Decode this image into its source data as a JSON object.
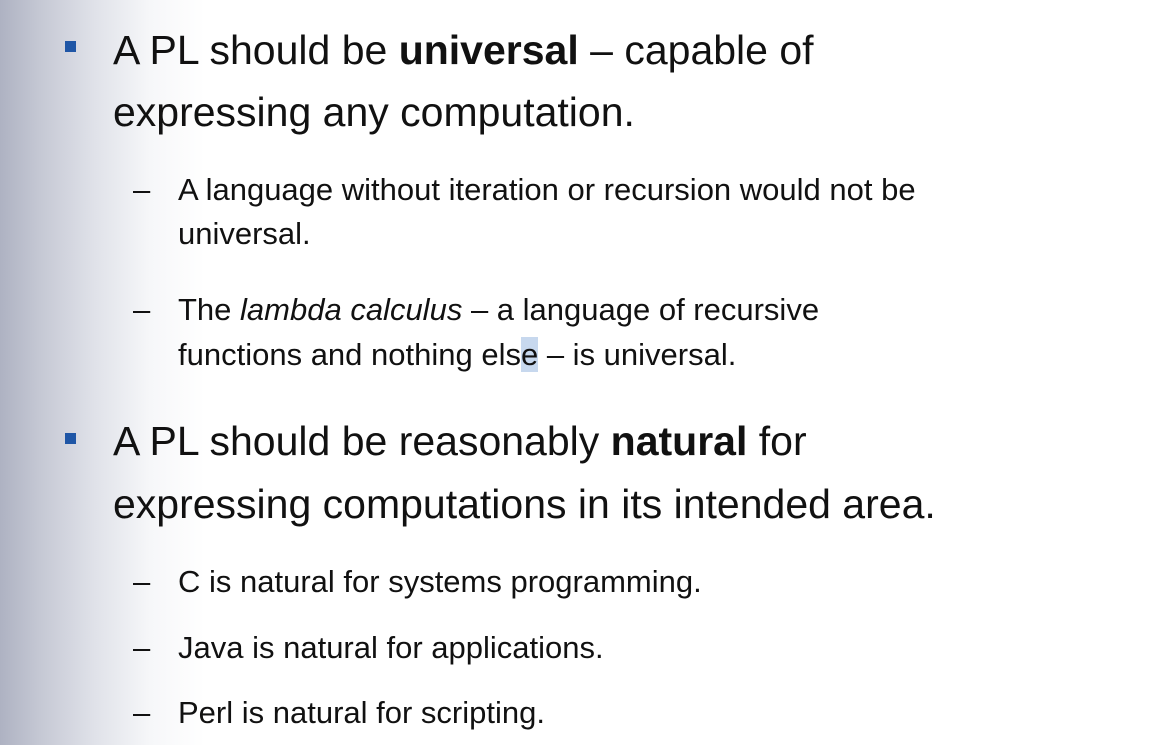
{
  "bullets": [
    {
      "line1_a": "A PL should be ",
      "line1_bold": "universal",
      "line1_b": " – capable of",
      "line2": "expressing any computation."
    },
    {
      "line1_a": "A PL should be reasonably ",
      "line1_bold": "natural",
      "line1_b": " for",
      "line2": "expressing computations in its intended area."
    }
  ],
  "sub": {
    "dash": "–",
    "s1_line1": "A language without iteration or recursion would not be",
    "s1_line2": "universal.",
    "s2_a": "The ",
    "s2_italic": "lambda calculus",
    "s2_b": " – a language of recursive",
    "s2_line2_a": "functions and nothing els",
    "s2_line2_sel": "e",
    "s2_line2_b": " – is universal.",
    "s3": "C is natural for systems programming.",
    "s4": "Java is natural for applications.",
    "s5": "Perl is natural for scripting."
  }
}
